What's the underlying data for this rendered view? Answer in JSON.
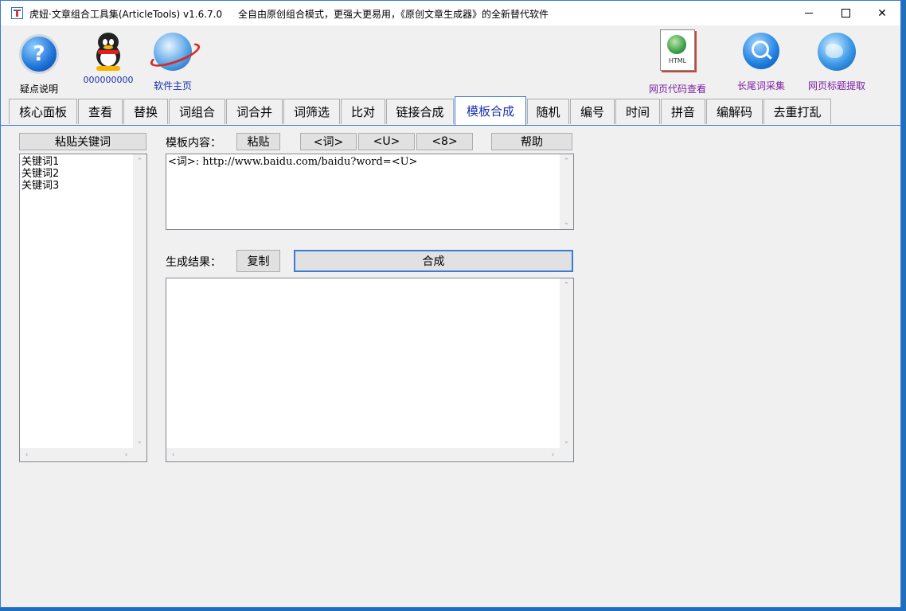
{
  "window": {
    "title": "虎妞·文章组合工具集(ArticleTools) v1.6.7.0",
    "subtitle": "全自由原创组合模式，更强大更易用，《原创文章生成器》的全新替代软件"
  },
  "toolbar": {
    "left": [
      {
        "label": "疑点说明",
        "icon": "help-icon"
      },
      {
        "label": "000000000",
        "icon": "qq-icon"
      },
      {
        "label": "软件主页",
        "icon": "globe-icon"
      }
    ],
    "right": [
      {
        "label": "网页代码查看",
        "icon": "html-icon"
      },
      {
        "label": "长尾词采集",
        "icon": "search-icon"
      },
      {
        "label": "网页标题提取",
        "icon": "web-globe-icon"
      }
    ]
  },
  "tabs": [
    "核心面板",
    "查看",
    "替换",
    "词组合",
    "词合并",
    "词筛选",
    "比对",
    "链接合成",
    "模板合成",
    "随机",
    "编号",
    "时间",
    "拼音",
    "编解码",
    "去重打乱"
  ],
  "active_tab": "模板合成",
  "left_panel": {
    "paste_keywords_label": "粘贴关键词",
    "keywords": [
      "关键词1",
      "关键词2",
      "关键词3"
    ]
  },
  "template": {
    "label": "模板内容：",
    "paste_label": "粘贴",
    "insert_word": "<词>",
    "insert_u": "<U>",
    "insert_8": "<8>",
    "help_label": "帮助",
    "content": "<词>: http://www.baidu.com/baidu?word=<U>"
  },
  "result": {
    "label": "生成结果：",
    "copy_label": "复制",
    "compose_label": "合成",
    "content": ""
  },
  "colors": {
    "accent": "#3a7bd5",
    "active_tab_text": "#1a2fae",
    "link_purple": "#7b1fa2"
  }
}
